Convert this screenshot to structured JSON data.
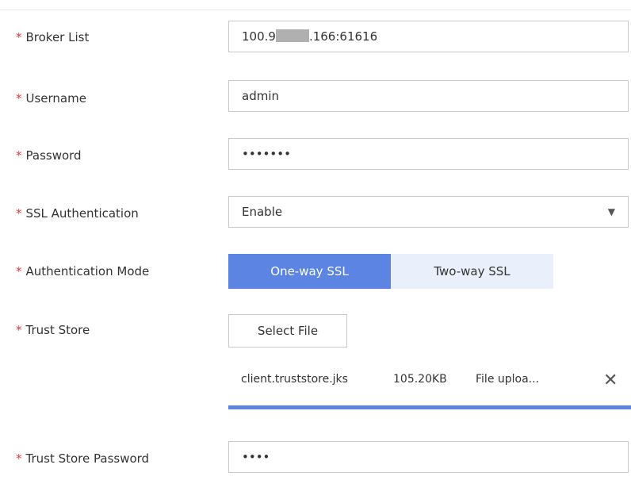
{
  "form": {
    "broker_list": {
      "label": "Broker List",
      "value_prefix": "100.9",
      "value_suffix": ".166:61616"
    },
    "username": {
      "label": "Username",
      "value": "admin"
    },
    "password": {
      "label": "Password",
      "value": "•••••••"
    },
    "ssl_authentication": {
      "label": "SSL Authentication",
      "value": "Enable",
      "caret_icon": "caret-down-icon"
    },
    "authentication_mode": {
      "label": "Authentication Mode",
      "options": [
        "One-way SSL",
        "Two-way SSL"
      ],
      "selected": "One-way SSL"
    },
    "trust_store": {
      "label": "Trust Store",
      "button_label": "Select File",
      "file": {
        "name": "client.truststore.jks",
        "size": "105.20KB",
        "status": "File uploa...",
        "close_glyph": "✕",
        "progress": 1.0
      }
    },
    "trust_store_password": {
      "label": "Trust Store Password",
      "value": "••••"
    },
    "required_mark": "*"
  },
  "colors": {
    "accent": "#5b84e3",
    "accent_light": "#e9effb",
    "required": "#e4393c",
    "border": "#c9c9c9"
  }
}
